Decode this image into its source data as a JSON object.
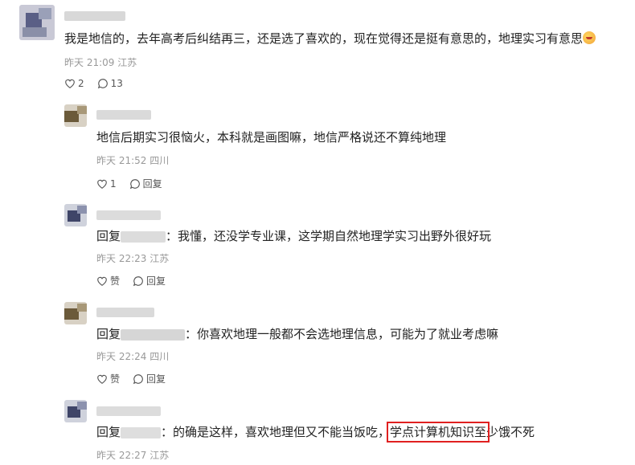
{
  "comments": [
    {
      "text": "我是地信的，去年高考后纠结再三，还是选了喜欢的，现在觉得还是挺有意思的，地理实习有意思",
      "emoji_icon": "grinning-face-emoji",
      "date": "昨天 21:09",
      "location": "江苏",
      "like_count": "2",
      "reply_count": "13"
    },
    {
      "text": "地信后期实习很恼火，本科就是画图嘛，地信严格说还不算纯地理",
      "date": "昨天 21:52",
      "location": "四川",
      "like_count": "1",
      "reply_label": "回复"
    },
    {
      "reply_prefix": "回复",
      "text": "：我懂，还没学专业课，这学期自然地理学实习出野外很好玩",
      "date": "昨天 22:23",
      "location": "江苏",
      "like_label": "赞",
      "reply_label": "回复"
    },
    {
      "reply_prefix": "回复",
      "text": "：你喜欢地理一般都不会选地理信息，可能为了就业考虑嘛",
      "date": "昨天 22:24",
      "location": "四川",
      "like_label": "赞",
      "reply_label": "回复"
    },
    {
      "reply_prefix": "回复",
      "text_before": "：的确是这样，喜欢地理但又不能当饭吃，",
      "text_highlight": "学点计算机知识至",
      "text_after": "少饿不死",
      "date": "昨天 22:27",
      "location": "江苏"
    }
  ],
  "colors": {
    "highlight_box": "#e02020",
    "meta_text": "#999999",
    "body_text": "#222222"
  }
}
